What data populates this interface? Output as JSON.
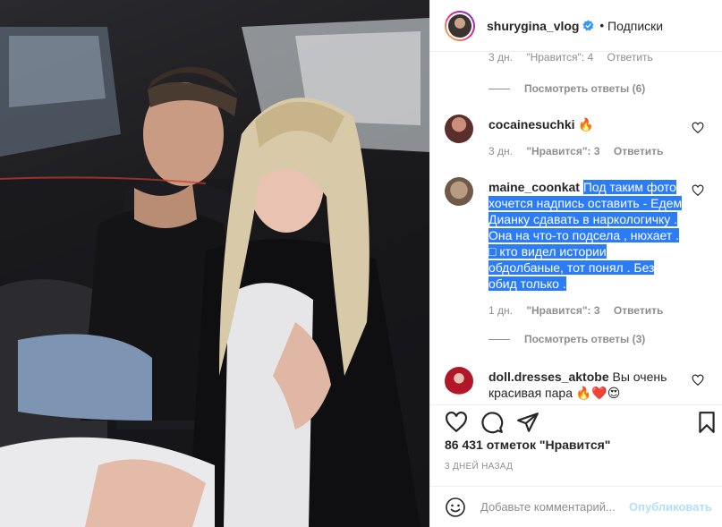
{
  "header": {
    "username": "shurygina_vlog",
    "dot": "•",
    "follow_label": "Подписки"
  },
  "comments": {
    "partial_meta": {
      "time": "3 дн.",
      "likes": "\"Нравится\": 4",
      "reply": "Ответить"
    },
    "view_replies_1": "Посмотреть ответы (6)",
    "c1": {
      "user": "cocainesuchki",
      "text": "🔥",
      "time": "3 дн.",
      "likes": "\"Нравится\": 3",
      "reply": "Ответить"
    },
    "c2": {
      "user": "maine_coonkat",
      "text_lines": [
        "Под таким фото",
        "хочется надпись оставить - Едем",
        "Дианку сдавать в наркологичку .",
        "Она на что-то подсела , нюхает .",
        "кто видел истории",
        "обдолбаные, тот понял . Без",
        "обид только ."
      ],
      "time": "1 дн.",
      "likes": "\"Нравится\": 3",
      "reply": "Ответить"
    },
    "view_replies_2": "Посмотреть ответы (3)",
    "c3": {
      "user": "doll.dresses_aktobe",
      "text_a": "Вы очень",
      "text_b": "красивая пара 🔥❤️😍"
    }
  },
  "post": {
    "likes_text": "86 431 отметок \"Нравится\"",
    "time_ago": "3 ДНЕЙ НАЗАД"
  },
  "add_comment": {
    "placeholder": "Добавьте комментарий...",
    "publish_label": "Опубликовать"
  },
  "colors": {
    "highlight": "#2b7cf6",
    "verified": "#3897f0",
    "muted": "#8e8e8e",
    "publish_disabled": "#b2dffc"
  },
  "icons": [
    "verified-icon",
    "heart-icon",
    "comment-icon",
    "share-icon",
    "bookmark-icon",
    "smile-icon"
  ]
}
